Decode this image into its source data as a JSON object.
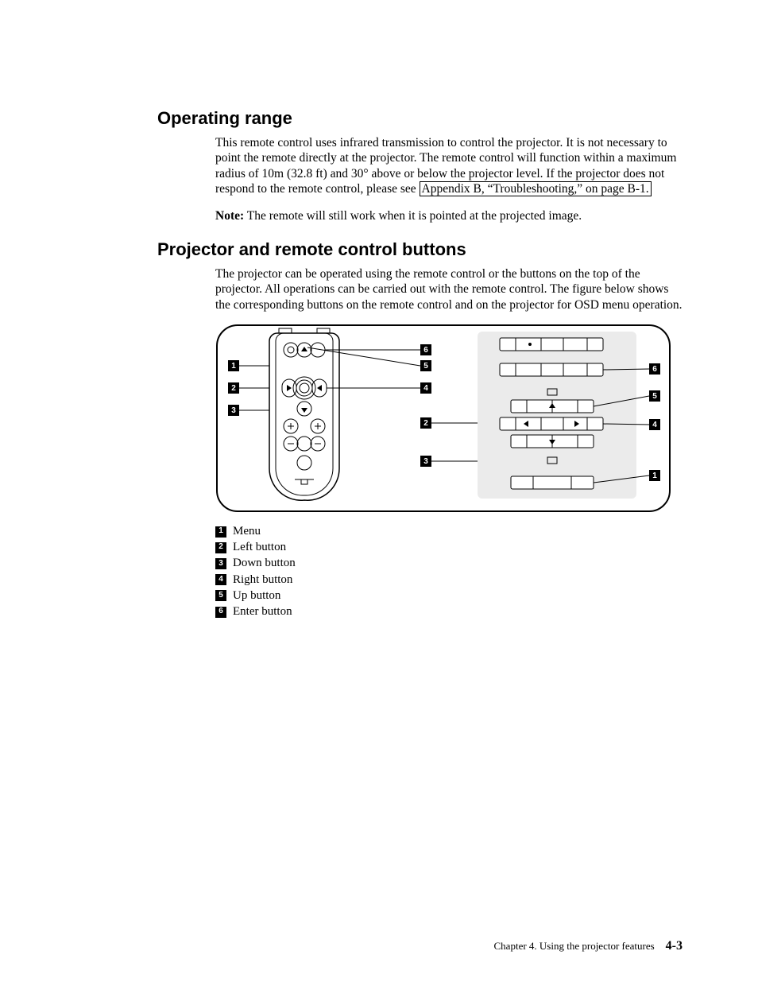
{
  "sections": {
    "s1": {
      "heading": "Operating range",
      "para": "This remote control uses infrared transmission to control the projector. It is not necessary to point the remote directly at the projector. The remote control will function within a maximum radius of 10m (32.8 ft) and 30° above or below the projector level. If the projector does not respond to the remote control, please see ",
      "xref": "Appendix B, “Troubleshooting,” on page B-1.",
      "note_label": "Note:",
      "note_text": " The remote will still work when it is pointed at the projected image."
    },
    "s2": {
      "heading": "Projector and remote control buttons",
      "para": "The projector can be operated using the remote control or the buttons on the top of the projector. All operations can be carried out with the remote control. The figure below shows the corresponding buttons on the remote control and on the projector for OSD menu operation."
    }
  },
  "legend": [
    {
      "n": "1",
      "label": "Menu"
    },
    {
      "n": "2",
      "label": "Left button"
    },
    {
      "n": "3",
      "label": "Down button"
    },
    {
      "n": "4",
      "label": "Right button"
    },
    {
      "n": "5",
      "label": "Up button"
    },
    {
      "n": "6",
      "label": "Enter button"
    }
  ],
  "callouts": {
    "left": [
      "1",
      "2",
      "3"
    ],
    "mid": [
      "6",
      "5",
      "4",
      "2",
      "3"
    ],
    "right": [
      "6",
      "5",
      "4",
      "1"
    ]
  },
  "footer": {
    "chapter": "Chapter 4. Using the projector features",
    "page": "4-3"
  }
}
